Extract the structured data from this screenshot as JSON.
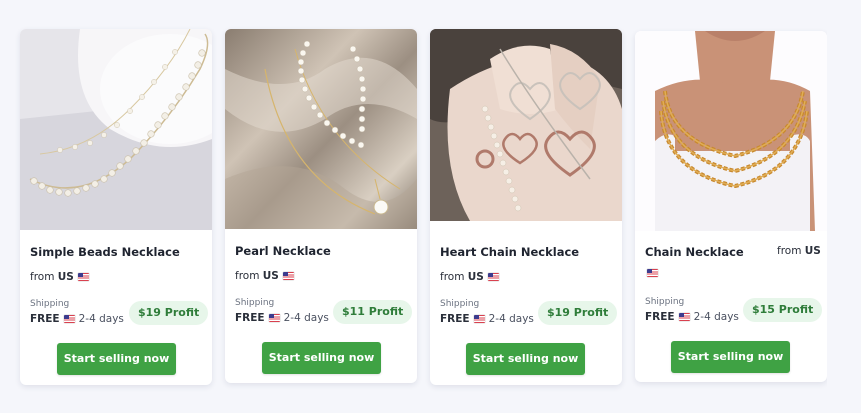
{
  "products": [
    {
      "title": "Simple Beads Necklace",
      "from_label": "from",
      "country": "US",
      "shipping_label": "Shipping",
      "shipping_free": "FREE",
      "shipping_days": "2-4 days",
      "profit": "$19 Profit",
      "cta": "Start selling now",
      "image_icon": "pearl-bead-necklace-photo"
    },
    {
      "title": "Pearl Necklace",
      "from_label": "from",
      "country": "US",
      "shipping_label": "Shipping",
      "shipping_free": "FREE",
      "shipping_days": "2-4 days",
      "profit": "$11 Profit",
      "cta": "Start selling now",
      "image_icon": "pearl-pendant-necklace-photo"
    },
    {
      "title": "Heart Chain Necklace",
      "from_label": "from",
      "country": "US",
      "shipping_label": "Shipping",
      "shipping_free": "FREE",
      "shipping_days": "2-4 days",
      "profit": "$19 Profit",
      "cta": "Start selling now",
      "image_icon": "heart-chain-necklace-photo"
    },
    {
      "title": "Chain Necklace",
      "from_label": "from",
      "country": "US",
      "shipping_label": "Shipping",
      "shipping_free": "FREE",
      "shipping_days": "2-4 days",
      "profit": "$15 Profit",
      "cta": "Start selling now",
      "image_icon": "gold-chain-necklace-photo"
    }
  ],
  "colors": {
    "cta": "#3fa244",
    "profit_bg": "#e7f6ea",
    "profit_text": "#2f7d3a",
    "page_bg": "#f5f6fb"
  }
}
